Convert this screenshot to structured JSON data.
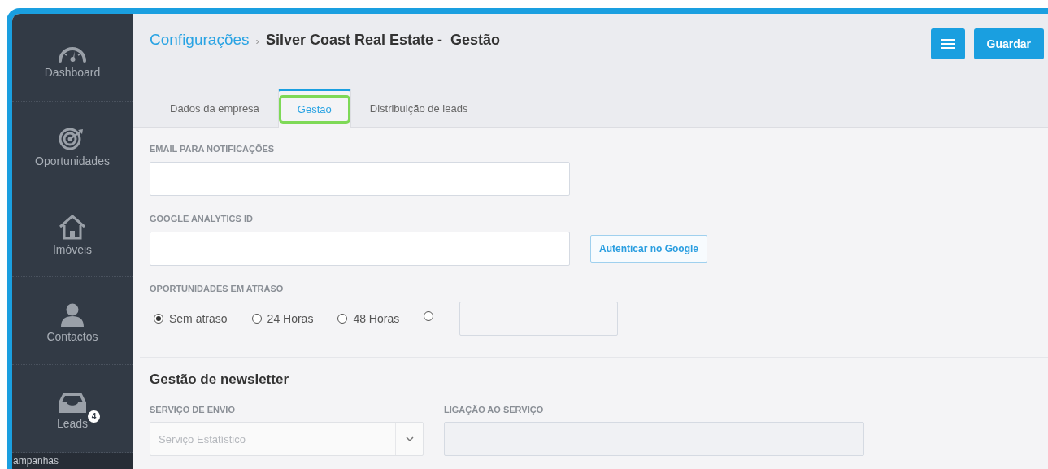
{
  "sidebar": {
    "items": [
      {
        "kind": "nav",
        "label": "Dashboard"
      },
      {
        "kind": "nav",
        "label": "Oportunidades"
      },
      {
        "kind": "nav",
        "label": "Imóveis"
      },
      {
        "kind": "nav",
        "label": "Contactos"
      },
      {
        "kind": "nav",
        "label": "Leads",
        "badge": "4"
      },
      {
        "kind": "section",
        "label": "ampanhas"
      }
    ]
  },
  "breadcrumb": {
    "parent": "Configurações",
    "separator": "›",
    "current": "Silver Coast Real Estate -  Gestão"
  },
  "actions": [
    {
      "kind": "menu"
    },
    {
      "kind": "text",
      "label": "Guardar"
    }
  ],
  "tabs": [
    {
      "label": "Dados da empresa",
      "selected": false,
      "highlighted": false
    },
    {
      "label": "Gestão",
      "selected": true,
      "highlighted": true
    },
    {
      "label": "Distribuição de leads",
      "selected": false,
      "highlighted": false
    }
  ],
  "fields": [
    {
      "label": "EMAIL PARA NOTIFICAÇÕES"
    },
    {
      "label": "GOOGLE ANALYTICS ID",
      "button": "Autenticar no Google"
    }
  ],
  "delay": {
    "label": "OPORTUNIDADES EM ATRASO",
    "options": [
      {
        "kind": "label",
        "label": "Sem atraso",
        "selected": true
      },
      {
        "kind": "label",
        "label": "24 Horas",
        "selected": false
      },
      {
        "kind": "label",
        "label": "48 Horas",
        "selected": false
      },
      {
        "kind": "custom",
        "selected": false
      }
    ]
  },
  "newsletter": {
    "title": "Gestão de newsletter",
    "fields": [
      {
        "kind": "select",
        "label": "SERVIÇO DE ENVIO",
        "value": "Serviço Estatístico",
        "disabled": true
      },
      {
        "kind": "text",
        "label": "LIGAÇÃO AO SERVIÇO",
        "disabled": true
      }
    ]
  }
}
